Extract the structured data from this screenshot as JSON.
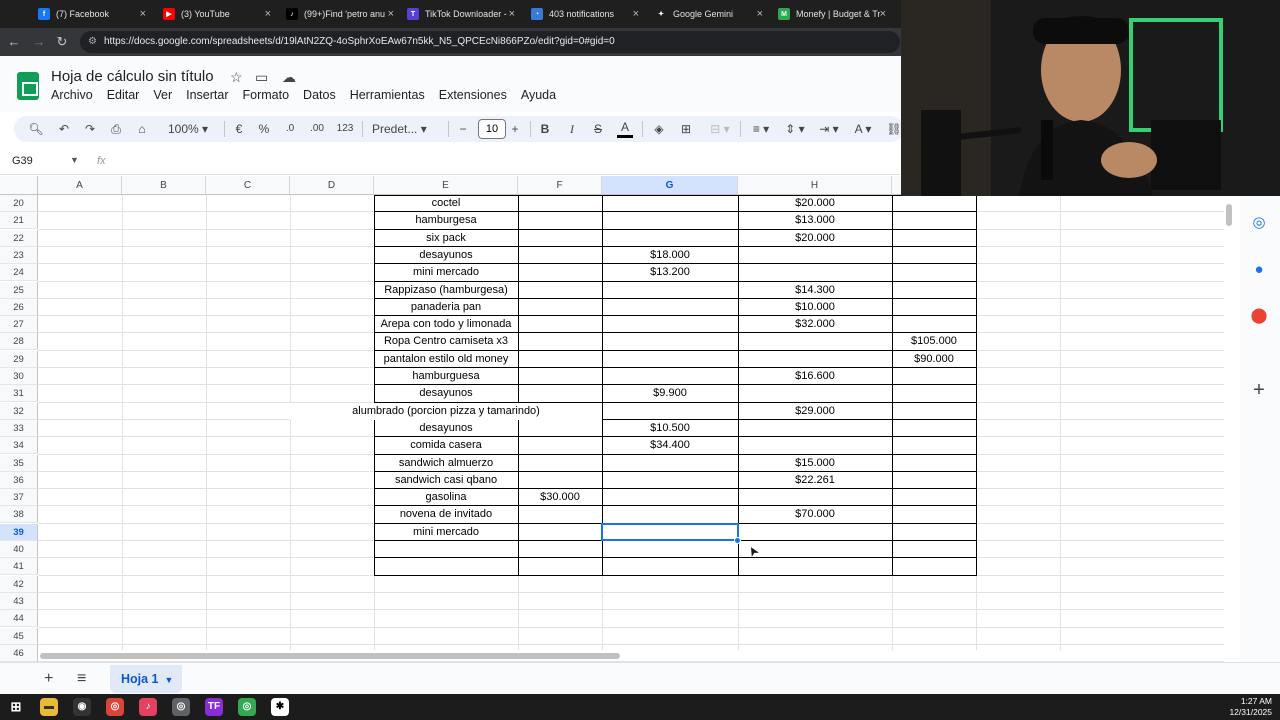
{
  "browser": {
    "tabs": [
      {
        "title": "(7) Facebook",
        "color": "#1877f2",
        "glyph": "f"
      },
      {
        "title": "(3) YouTube",
        "color": "#ff0000",
        "glyph": "▶"
      },
      {
        "title": "(99+)Find 'petro anu",
        "color": "#000000",
        "glyph": "♪"
      },
      {
        "title": "TikTok Downloader -",
        "color": "#5b3fd1",
        "glyph": "T"
      },
      {
        "title": "403 notifications",
        "color": "#3a7bd5",
        "glyph": "◔"
      },
      {
        "title": "Google Gemini",
        "color": "#1f1f1f",
        "glyph": "✦"
      },
      {
        "title": "Monefy | Budget & Tr",
        "color": "#2fa84f",
        "glyph": "M"
      }
    ],
    "url": "https://docs.google.com/spreadsheets/d/19lAtN2ZQ-4oSphrXoEAw67n5kk_N5_QPCEcNi866PZo/edit?gid=0#gid=0"
  },
  "doc": {
    "title": "Hoja de cálculo sin título",
    "menus": [
      "Archivo",
      "Editar",
      "Ver",
      "Insertar",
      "Formato",
      "Datos",
      "Herramientas",
      "Extensiones",
      "Ayuda"
    ]
  },
  "toolbar": {
    "zoom": "100%",
    "currency": "€",
    "percent": "%",
    "dec_decrease": ".0",
    "dec_increase": ".00",
    "number_format": "123",
    "font": "Predet...",
    "font_size": "10"
  },
  "formula_bar": {
    "cell_ref": "G39",
    "fx": "fx"
  },
  "grid": {
    "columns": [
      "A",
      "B",
      "C",
      "D",
      "E",
      "F",
      "G",
      "H"
    ],
    "selected_column": "G",
    "selected_row": "39",
    "rows": [
      {
        "n": "20",
        "E": "coctel",
        "F": "",
        "G": "",
        "H": "$20.000",
        "I": ""
      },
      {
        "n": "21",
        "E": "hamburgesa",
        "F": "",
        "G": "",
        "H": "$13.000",
        "I": ""
      },
      {
        "n": "22",
        "E": "six pack",
        "F": "",
        "G": "",
        "H": "$20.000",
        "I": ""
      },
      {
        "n": "23",
        "E": "desayunos",
        "F": "",
        "G": "$18.000",
        "H": "",
        "I": ""
      },
      {
        "n": "24",
        "E": "mini mercado",
        "F": "",
        "G": "$13.200",
        "H": "",
        "I": ""
      },
      {
        "n": "25",
        "E": "Rappizaso (hamburgesa)",
        "F": "",
        "G": "",
        "H": "$14.300",
        "I": ""
      },
      {
        "n": "26",
        "E": "panaderia pan",
        "F": "",
        "G": "",
        "H": "$10.000",
        "I": ""
      },
      {
        "n": "27",
        "E": "Arepa con todo y limonada",
        "F": "",
        "G": "",
        "H": "$32.000",
        "I": ""
      },
      {
        "n": "28",
        "E": "Ropa Centro camiseta x3",
        "F": "",
        "G": "",
        "H": "",
        "I": "$105.000"
      },
      {
        "n": "29",
        "E": "pantalon estilo old money",
        "F": "",
        "G": "",
        "H": "",
        "I": "$90.000"
      },
      {
        "n": "30",
        "E": "hamburguesa",
        "F": "",
        "G": "",
        "H": "$16.600",
        "I": ""
      },
      {
        "n": "31",
        "E": "desayunos",
        "F": "",
        "G": "$9.900",
        "H": "",
        "I": ""
      },
      {
        "n": "32",
        "E": "alumbrado (porcion pizza y tamarindo)",
        "F": "",
        "G": "",
        "H": "$29.000",
        "I": ""
      },
      {
        "n": "33",
        "E": "desayunos",
        "F": "",
        "G": "$10.500",
        "H": "",
        "I": ""
      },
      {
        "n": "34",
        "E": "comida casera",
        "F": "",
        "G": "$34.400",
        "H": "",
        "I": ""
      },
      {
        "n": "35",
        "E": "sandwich almuerzo",
        "F": "",
        "G": "",
        "H": "$15.000",
        "I": ""
      },
      {
        "n": "36",
        "E": "sandwich casi qbano",
        "F": "",
        "G": "",
        "H": "$22.261",
        "I": ""
      },
      {
        "n": "37",
        "E": "gasolina",
        "F": "$30.000",
        "G": "",
        "H": "",
        "I": ""
      },
      {
        "n": "38",
        "E": "novena de invitado",
        "F": "",
        "G": "",
        "H": "$70.000",
        "I": ""
      },
      {
        "n": "39",
        "E": "mini mercado",
        "F": "",
        "G": "",
        "H": "",
        "I": ""
      },
      {
        "n": "40",
        "E": "",
        "F": "",
        "G": "",
        "H": "",
        "I": ""
      },
      {
        "n": "41",
        "E": "",
        "F": "",
        "G": "",
        "H": "",
        "I": ""
      },
      {
        "n": "42",
        "E": "",
        "F": "",
        "G": "",
        "H": "",
        "I": ""
      },
      {
        "n": "43",
        "E": "",
        "F": "",
        "G": "",
        "H": "",
        "I": ""
      },
      {
        "n": "44",
        "E": "",
        "F": "",
        "G": "",
        "H": "",
        "I": ""
      },
      {
        "n": "45",
        "E": "",
        "F": "",
        "G": "",
        "H": "",
        "I": ""
      },
      {
        "n": "46",
        "E": "",
        "F": "",
        "G": "",
        "H": "",
        "I": ""
      }
    ]
  },
  "sheet_tab": "Hoja 1",
  "clock": {
    "time": "1:27 AM",
    "date": "12/31/2025"
  }
}
